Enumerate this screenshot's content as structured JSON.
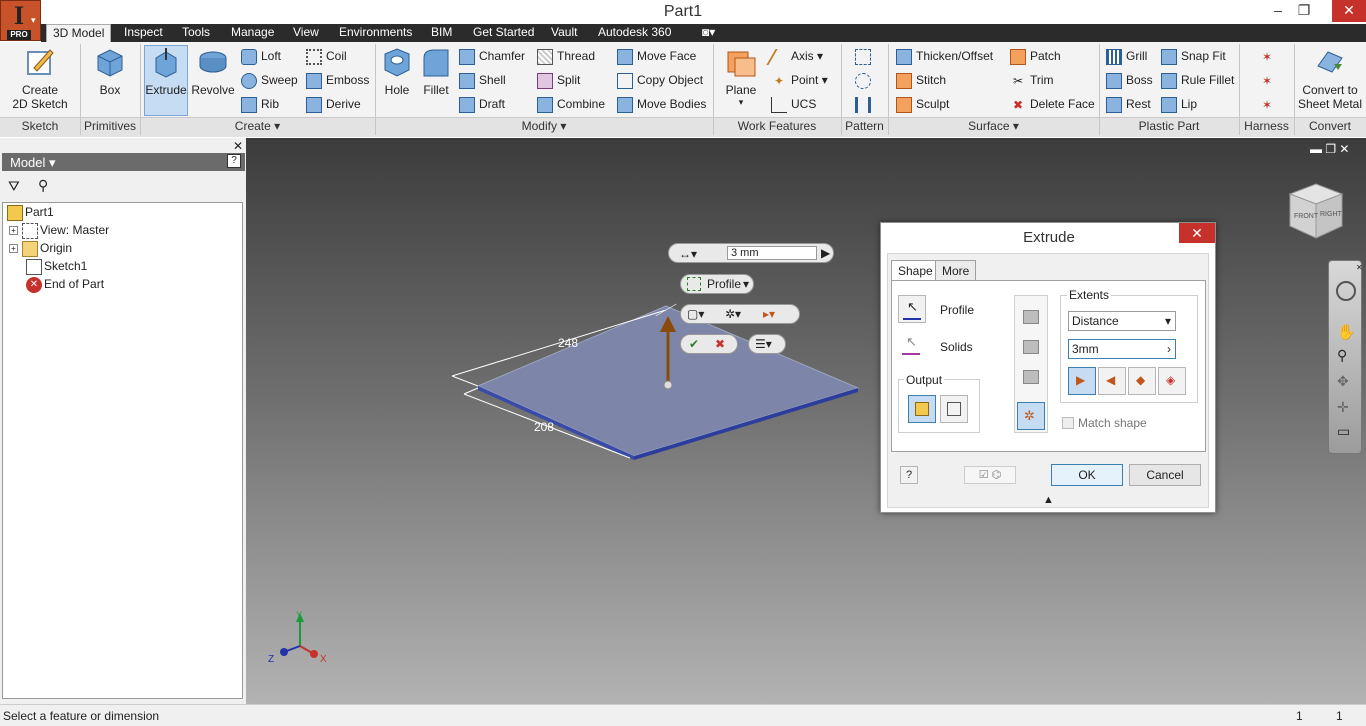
{
  "window": {
    "title": "Part1",
    "app_badge": "PRO",
    "app_letter": "I",
    "minimize": "–",
    "maximize": "❐",
    "close": "✕"
  },
  "menu_tabs": [
    "3D Model",
    "Inspect",
    "Tools",
    "Manage",
    "View",
    "Environments",
    "BIM",
    "Get Started",
    "Vault",
    "Autodesk 360"
  ],
  "ribbon": {
    "sketch": {
      "label": "Sketch",
      "create_2d_sketch_line1": "Create",
      "create_2d_sketch_line2": "2D Sketch"
    },
    "primitives": {
      "label": "Primitives",
      "box": "Box"
    },
    "create": {
      "label": "Create",
      "extrude": "Extrude",
      "revolve": "Revolve",
      "loft": "Loft",
      "coil": "Coil",
      "sweep": "Sweep",
      "emboss": "Emboss",
      "rib": "Rib",
      "derive": "Derive"
    },
    "modify": {
      "label": "Modify",
      "hole": "Hole",
      "fillet": "Fillet",
      "chamfer": "Chamfer",
      "thread": "Thread",
      "move_face": "Move Face",
      "shell": "Shell",
      "split": "Split",
      "copy_object": "Copy Object",
      "draft": "Draft",
      "combine": "Combine",
      "move_bodies": "Move Bodies"
    },
    "work_features": {
      "label": "Work Features",
      "plane": "Plane",
      "axis": "Axis",
      "point": "Point",
      "ucs": "UCS"
    },
    "pattern": {
      "label": "Pattern"
    },
    "surface": {
      "label": "Surface",
      "thicken_offset": "Thicken/Offset",
      "patch": "Patch",
      "stitch": "Stitch",
      "trim": "Trim",
      "sculpt": "Sculpt",
      "delete_face": "Delete Face"
    },
    "plastic_part": {
      "label": "Plastic Part",
      "grill": "Grill",
      "snap_fit": "Snap Fit",
      "boss": "Boss",
      "rule_fillet": "Rule Fillet",
      "rest": "Rest",
      "lip": "Lip"
    },
    "harness": {
      "label": "Harness"
    },
    "convert": {
      "label": "Convert",
      "convert_line1": "Convert to",
      "convert_line2": "Sheet Metal"
    }
  },
  "browser": {
    "title": "Model",
    "items": [
      {
        "label": "Part1"
      },
      {
        "label": "View: Master"
      },
      {
        "label": "Origin"
      },
      {
        "label": "Sketch1"
      },
      {
        "label": "End of Part"
      }
    ]
  },
  "viewport": {
    "dim_length": "248",
    "dim_width": "208",
    "distance_value": "3 mm",
    "profile_label": "Profile",
    "triad": {
      "x": "X",
      "y": "Y",
      "z": "Z"
    },
    "viewcube": {
      "front": "FRONT",
      "right": "RIGHT"
    }
  },
  "extrude_dialog": {
    "title": "Extrude",
    "tab_shape": "Shape",
    "tab_more": "More",
    "profile": "Profile",
    "solids": "Solids",
    "output": "Output",
    "extents": "Extents",
    "extents_type": "Distance",
    "distance": "3mm",
    "match_shape": "Match shape",
    "ok": "OK",
    "cancel": "Cancel",
    "help": "?"
  },
  "status": {
    "text": "Select a feature or dimension",
    "count1": "1",
    "count2": "1"
  }
}
